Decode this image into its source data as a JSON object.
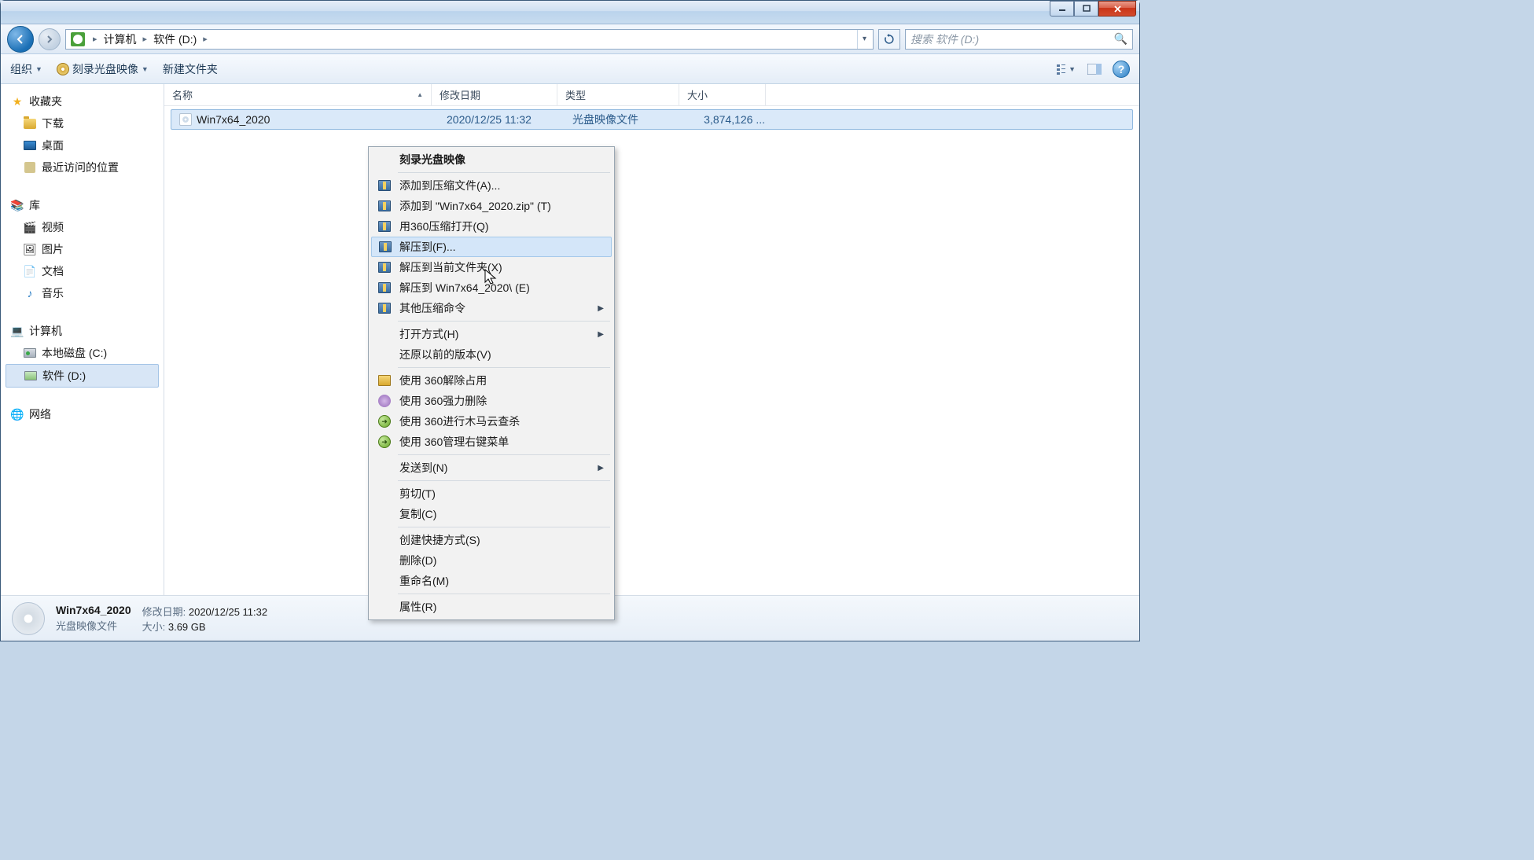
{
  "breadcrumb": {
    "root": "计算机",
    "current": "软件 (D:)"
  },
  "search": {
    "placeholder": "搜索 软件 (D:)"
  },
  "toolbar": {
    "organize": "组织",
    "burn": "刻录光盘映像",
    "newfolder": "新建文件夹"
  },
  "columns": {
    "name": "名称",
    "date": "修改日期",
    "type": "类型",
    "size": "大小"
  },
  "sidebar": {
    "favorites": "收藏夹",
    "downloads": "下载",
    "desktop": "桌面",
    "recent": "最近访问的位置",
    "libraries": "库",
    "videos": "视频",
    "pictures": "图片",
    "documents": "文档",
    "music": "音乐",
    "computer": "计算机",
    "drive_c": "本地磁盘 (C:)",
    "drive_d": "软件 (D:)",
    "network": "网络"
  },
  "file": {
    "name": "Win7x64_2020",
    "date": "2020/12/25 11:32",
    "type": "光盘映像文件",
    "size": "3,874,126 ..."
  },
  "context": {
    "burn": "刻录光盘映像",
    "add_archive": "添加到压缩文件(A)...",
    "add_zip": "添加到 \"Win7x64_2020.zip\" (T)",
    "open_360zip": "用360压缩打开(Q)",
    "extract_to": "解压到(F)...",
    "extract_here": "解压到当前文件夹(X)",
    "extract_folder": "解压到 Win7x64_2020\\ (E)",
    "other_zip": "其他压缩命令",
    "open_with": "打开方式(H)",
    "restore": "还原以前的版本(V)",
    "unlock360": "使用 360解除占用",
    "forcedel360": "使用 360强力删除",
    "trojan360": "使用 360进行木马云查杀",
    "menu360": "使用 360管理右键菜单",
    "send_to": "发送到(N)",
    "cut": "剪切(T)",
    "copy": "复制(C)",
    "shortcut": "创建快捷方式(S)",
    "delete": "删除(D)",
    "rename": "重命名(M)",
    "properties": "属性(R)"
  },
  "details": {
    "name": "Win7x64_2020",
    "type": "光盘映像文件",
    "date_label": "修改日期:",
    "date": "2020/12/25 11:32",
    "size_label": "大小:",
    "size": "3.69 GB"
  }
}
